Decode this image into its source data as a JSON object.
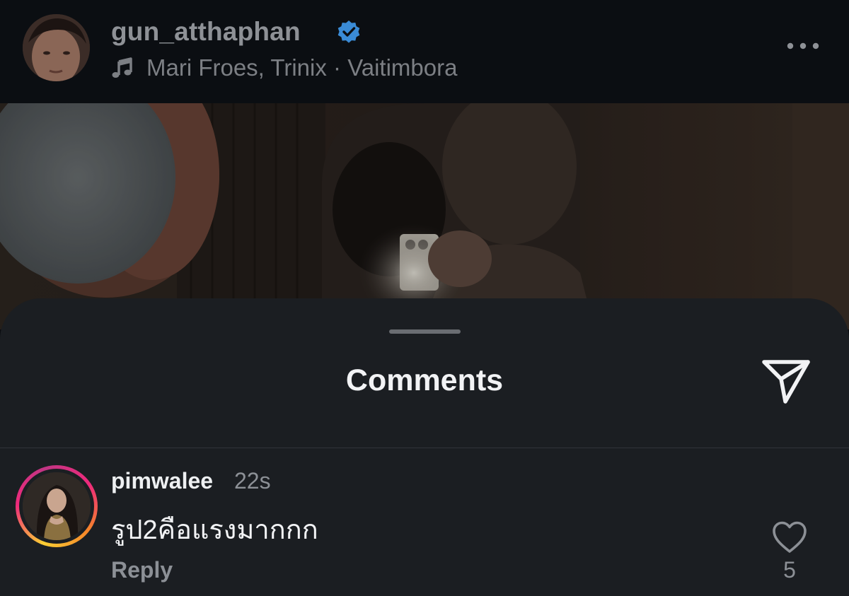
{
  "post": {
    "author_username": "gun_atthaphan",
    "music": "Mari Froes, Trinix · Vaitimbora",
    "icons": {
      "verified": "verified-badge-icon",
      "music": "music-note-icon",
      "more": "more-options-icon"
    },
    "colors": {
      "verified": "#3a8bd6"
    }
  },
  "comments_sheet": {
    "title": "Comments",
    "share_icon": "paper-plane-icon",
    "comments": [
      {
        "username": "pimwalee",
        "time": "22s",
        "text": "รูป2คือแรงมากกก",
        "reply_label": "Reply",
        "like_count": "5",
        "has_story_ring": true
      }
    ]
  }
}
